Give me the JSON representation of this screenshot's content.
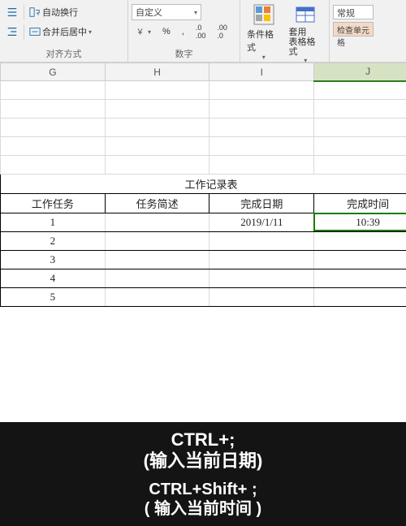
{
  "ribbon": {
    "alignment": {
      "wrap_label": "自动换行",
      "merge_label": "合并后居中",
      "group_label": "对齐方式"
    },
    "number": {
      "format_value": "自定义",
      "percent": "%",
      "comma": ",",
      "inc_dec_1": "←.0",
      "inc_dec_2": ".00→",
      "currency": "¥",
      "group_label": "数字"
    },
    "styles": {
      "cond_fmt": "条件格式",
      "as_table": "套用\n表格格式",
      "styles_label": "常规",
      "check_cells": "检查单元格"
    }
  },
  "columns": [
    "G",
    "H",
    "I",
    "J"
  ],
  "selected_column": "J",
  "table": {
    "title": "工作记录表",
    "headers": [
      "工作任务",
      "任务简述",
      "完成日期",
      "完成时间"
    ],
    "rows": [
      {
        "task": "1",
        "desc": "",
        "date": "2019/1/11",
        "time": "10:39"
      },
      {
        "task": "2",
        "desc": "",
        "date": "",
        "time": ""
      },
      {
        "task": "3",
        "desc": "",
        "date": "",
        "time": ""
      },
      {
        "task": "4",
        "desc": "",
        "date": "",
        "time": ""
      },
      {
        "task": "5",
        "desc": "",
        "date": "",
        "time": ""
      }
    ]
  },
  "overlay": {
    "shortcut1": "CTRL+;",
    "desc1": "(输入当前日期)",
    "shortcut2": "CTRL+Shift+ ;",
    "desc2": "( 输入当前时间 )"
  }
}
